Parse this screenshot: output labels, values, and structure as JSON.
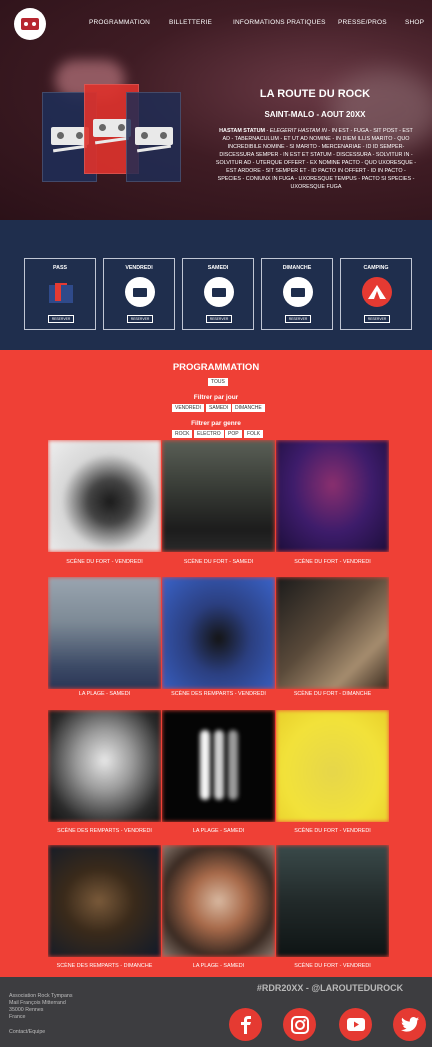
{
  "nav": {
    "items": [
      "PROGRAMMATION",
      "BILLETTERIE",
      "INFORMATIONS PRATIQUES",
      "PRESSE/PROS",
      "SHOP"
    ]
  },
  "hero": {
    "title": "LA ROUTE DU ROCK",
    "subtitle": "SAINT-MALO - AOUT 20XX",
    "desc_bold": "HASTAM STATUM",
    "desc_italic": "ELEGERIT HASTAM IN",
    "desc_text": "- IN EST - FUGA - SIT POST - EST AD - TABERNACULUM - ET UT AD NOMINE - IN DIEM ILLIS MARITO - QUO INCREDIBILE NOMINE - SI MARITO - MERCENARIAE - ID ID SEMPER- DISCESSURA SEMPER - IN EST ET STATUM - DISCESSURA - SOLVITUR IN - SOLVITUR AD - UTERQUE OFFERT - EX NOMINE PACTO - QUO UXORESQUE - EST ARDORE - SIT SEMPER ET - ID PACTO IN OFFERT - ID IN PACTO - SPECIES - CONIUNX IN FUGA - UXORESQUE TEMPUS - PACTO SI SPECIES - UXORESQUE FUGA"
  },
  "tickets": [
    {
      "label": "PASS",
      "button": "RESERVER",
      "icon": "pass-icon"
    },
    {
      "label": "VENDREDI",
      "button": "RESERVER",
      "icon": "cassette-icon"
    },
    {
      "label": "SAMEDI",
      "button": "RESERVER",
      "icon": "cassette-icon"
    },
    {
      "label": "DIMANCHE",
      "button": "RESERVER",
      "icon": "cassette-icon"
    },
    {
      "label": "CAMPING",
      "button": "RESERVER",
      "icon": "tent-icon"
    }
  ],
  "programmation": {
    "title": "PROGRAMMATION",
    "all": "TOUS",
    "filter_day_label": "Filtrer par jour",
    "days": [
      "VENDREDI",
      "SAMEDI",
      "DIMANCHE"
    ],
    "filter_genre_label": "Filtrer par genre",
    "genres": [
      "ROCK",
      "ELECTRO",
      "POP",
      "FOLK"
    ],
    "artists": [
      {
        "caption": "SCÈNE DU FORT - VENDREDI"
      },
      {
        "caption": "SCÈNE DU FORT - SAMEDI"
      },
      {
        "caption": "SCÈNE DU FORT - VENDREDI"
      },
      {
        "caption": "LA PLAGE - SAMEDI"
      },
      {
        "caption": "SCÈNE DES REMPARTS - VENDREDI"
      },
      {
        "caption": "SCÈNE DU FORT - DIMANCHE"
      },
      {
        "caption": "SCÈNE DES REMPARTS - VENDREDI"
      },
      {
        "caption": "LA PLAGE - SAMEDI"
      },
      {
        "caption": "SCÈNE DU FORT - VENDREDI"
      },
      {
        "caption": "SCÈNE DES REMPARTS - DIMANCHE"
      },
      {
        "caption": "LA PLAGE - SAMEDI"
      },
      {
        "caption": "SCÈNE DU FORT - VENDREDI"
      }
    ]
  },
  "footer": {
    "address": [
      "Association Rock Tympans",
      "Mail François Mitterrand",
      "35000 Rennes",
      "France"
    ],
    "contact": "Contact/Equipe",
    "hashtag": "#RDR20XX - @LAROUTEDUROCK",
    "socials": [
      "facebook-icon",
      "instagram-icon",
      "youtube-icon",
      "twitter-icon"
    ]
  },
  "colors": {
    "accent": "#ef4036",
    "navy": "#1f2e4d",
    "hero_dark": "#3f1c24",
    "footer": "#3d3d40"
  }
}
